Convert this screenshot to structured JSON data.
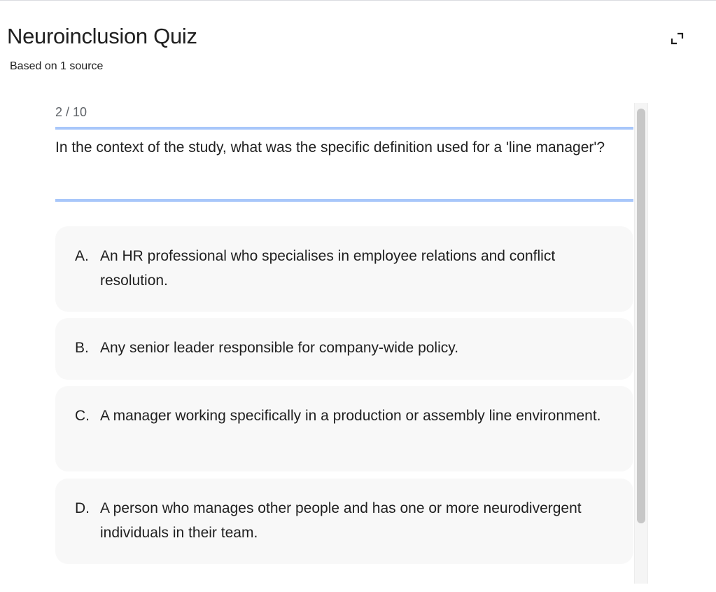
{
  "header": {
    "title": "Neuroinclusion Quiz",
    "subtitle": "Based on 1 source",
    "expand_icon": "expand-icon"
  },
  "quiz": {
    "progress": "2 / 10",
    "question": "In the context of the study, what was the specific definition used for a 'line manager'?",
    "options": [
      {
        "letter": "A.",
        "text": "An HR professional who specialises in employee relations and conflict resolution."
      },
      {
        "letter": "B.",
        "text": "Any senior leader responsible for company-wide policy."
      },
      {
        "letter": "C.",
        "text": "A manager working specifically in a production or assembly line environment."
      },
      {
        "letter": "D.",
        "text": "A person who manages other people and has one or more neurodivergent individuals in their team."
      }
    ]
  },
  "colors": {
    "accent_line": "#a8c7fa",
    "option_bg": "#f8f8f8",
    "scrollbar_thumb": "#c7c7c7",
    "muted_text": "#5f6368"
  }
}
